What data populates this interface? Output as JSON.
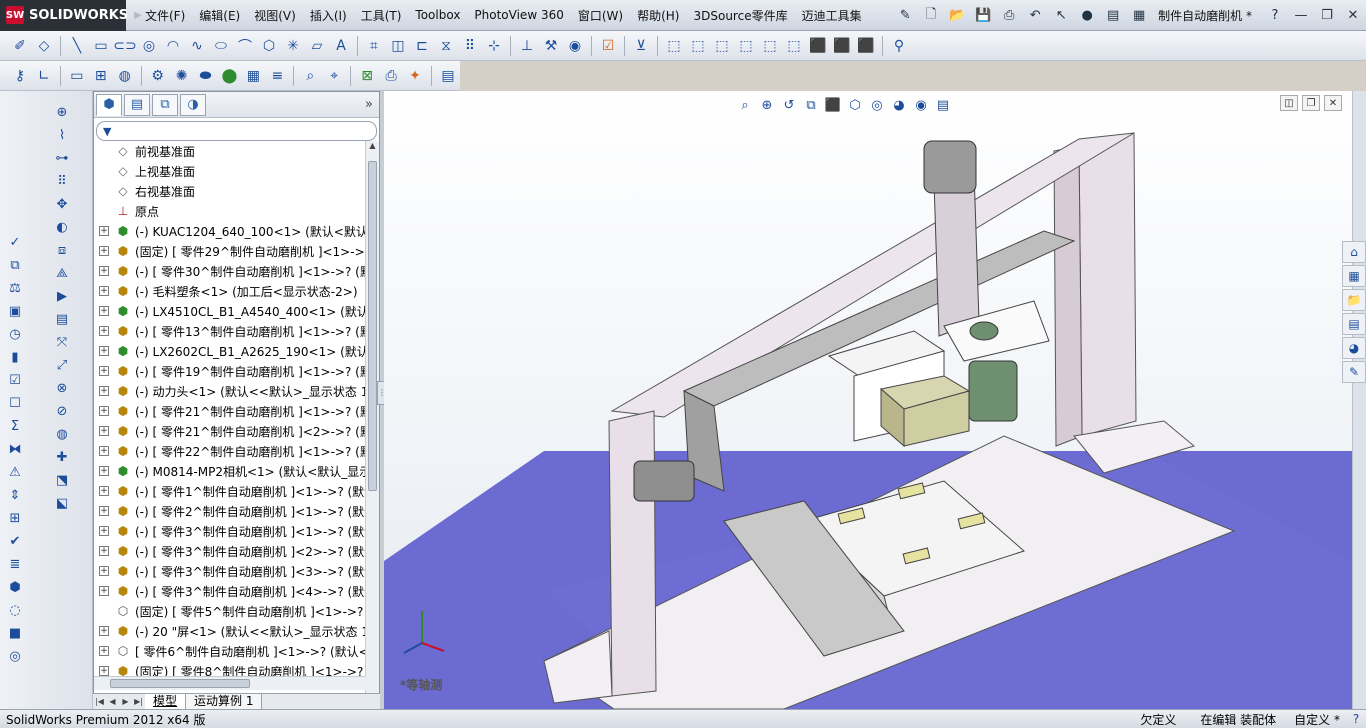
{
  "app": {
    "logo_text": "SOLIDWORKS",
    "logo_mark": "SW",
    "document_title": "制件自动磨削机 *"
  },
  "menu": {
    "items": [
      "文件(F)",
      "编辑(E)",
      "视图(V)",
      "插入(I)",
      "工具(T)",
      "Toolbox",
      "PhotoView 360",
      "窗口(W)",
      "帮助(H)",
      "3DSource零件库",
      "迈迪工具集"
    ]
  },
  "feature_tree": {
    "tabs": [
      "feature-manager",
      "property-manager",
      "configuration-manager",
      "display-manager"
    ],
    "items": [
      {
        "label": "前视基准面",
        "icon": "plane-icon",
        "expandable": false
      },
      {
        "label": "上视基准面",
        "icon": "plane-icon",
        "expandable": false
      },
      {
        "label": "右视基准面",
        "icon": "plane-icon",
        "expandable": false
      },
      {
        "label": "原点",
        "icon": "origin-icon",
        "expandable": false
      },
      {
        "label": "(-) KUAC1204_640_100<1> (默认<默认_显",
        "icon": "assembly-icon",
        "expandable": true
      },
      {
        "label": "(固定) [ 零件29^制件自动磨削机 ]<1>->? (",
        "icon": "part-icon",
        "expandable": true
      },
      {
        "label": "(-) [ 零件30^制件自动磨削机 ]<1>->? (默",
        "icon": "part-icon",
        "expandable": true
      },
      {
        "label": "(-) 毛料塑条<1> (加工后<显示状态-2>)",
        "icon": "part-icon",
        "expandable": true
      },
      {
        "label": "(-) LX4510CL_B1_A4540_400<1> (默认<默",
        "icon": "assembly-icon",
        "expandable": true
      },
      {
        "label": "(-) [ 零件13^制件自动磨削机 ]<1>->? (默",
        "icon": "part-icon",
        "expandable": true
      },
      {
        "label": "(-) LX2602CL_B1_A2625_190<1> (默认<默",
        "icon": "assembly-icon",
        "expandable": true
      },
      {
        "label": "(-) [ 零件19^制件自动磨削机 ]<1>->? (默",
        "icon": "part-icon",
        "expandable": true
      },
      {
        "label": "(-) 动力头<1> (默认<<默认>_显示状态 1>",
        "icon": "part-icon",
        "expandable": true
      },
      {
        "label": "(-) [ 零件21^制件自动磨削机 ]<1>->? (默",
        "icon": "part-icon",
        "expandable": true
      },
      {
        "label": "(-) [ 零件21^制件自动磨削机 ]<2>->? (默",
        "icon": "part-icon",
        "expandable": true
      },
      {
        "label": "(-) [ 零件22^制件自动磨削机 ]<1>->? (默",
        "icon": "part-icon",
        "expandable": true
      },
      {
        "label": "(-) M0814-MP2相机<1> (默认<默认_显示",
        "icon": "assembly-icon",
        "expandable": true
      },
      {
        "label": "(-) [ 零件1^制件自动磨削机 ]<1>->? (默认",
        "icon": "part-icon",
        "expandable": true
      },
      {
        "label": "(-) [ 零件2^制件自动磨削机 ]<1>->? (默认",
        "icon": "part-icon",
        "expandable": true
      },
      {
        "label": "(-) [ 零件3^制件自动磨削机 ]<1>->? (默认",
        "icon": "part-icon",
        "expandable": true
      },
      {
        "label": "(-) [ 零件3^制件自动磨削机 ]<2>->? (默认",
        "icon": "part-icon",
        "expandable": true
      },
      {
        "label": "(-) [ 零件3^制件自动磨削机 ]<3>->? (默认",
        "icon": "part-icon",
        "expandable": true
      },
      {
        "label": "(-) [ 零件3^制件自动磨削机 ]<4>->? (默认",
        "icon": "part-icon",
        "expandable": true
      },
      {
        "label": "(固定) [ 零件5^制件自动磨削机 ]<1>->? (",
        "icon": "subassembly-icon",
        "expandable": false
      },
      {
        "label": "(-) 20 \"屏<1> (默认<<默认>_显示状态 1",
        "icon": "part-icon",
        "expandable": true
      },
      {
        "label": "[ 零件6^制件自动磨削机 ]<1>->? (默认<<",
        "icon": "subassembly-icon",
        "expandable": true
      },
      {
        "label": "(固定) [ 零件8^制件自动磨削机 ]<1>->? (",
        "icon": "part-icon",
        "expandable": true
      }
    ]
  },
  "bottom_tabs": [
    "模型",
    "运动算例 1"
  ],
  "viewport": {
    "view_label": "*等轴测",
    "background_floor_color": "#6b6bd1",
    "frame_color": "#e8dfe8"
  },
  "status": {
    "app_version": "SolidWorks Premium 2012 x64 版",
    "definition": "欠定义",
    "editing": "在编辑 装配体",
    "units": "自定义 *"
  }
}
